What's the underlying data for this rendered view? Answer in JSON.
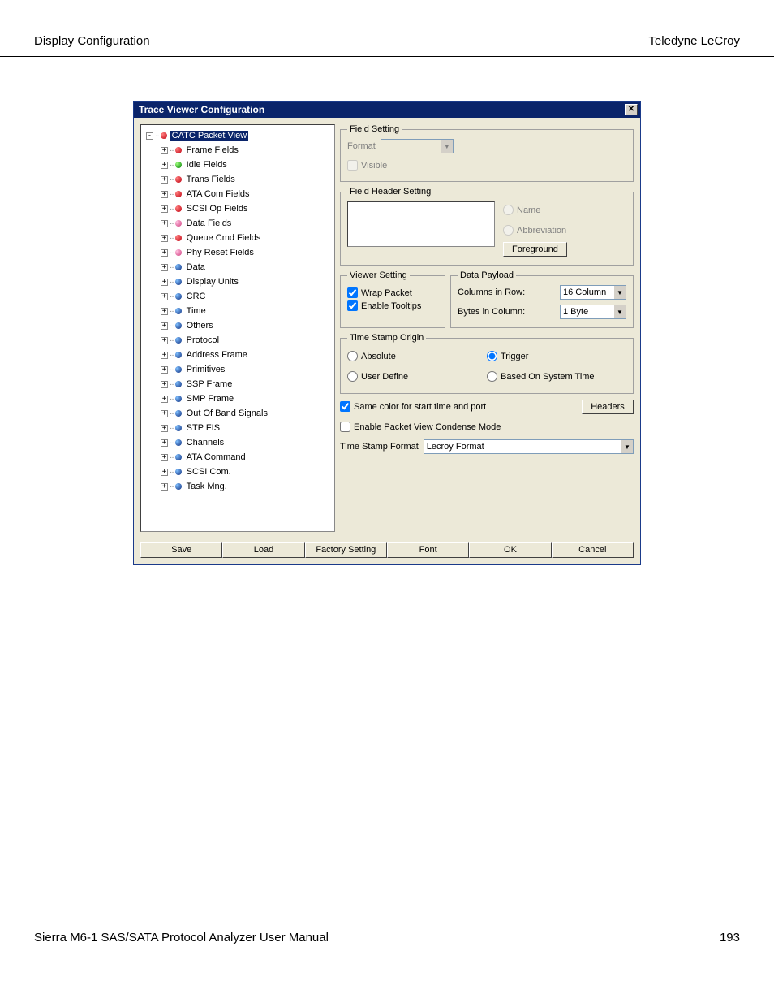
{
  "page": {
    "header_left": "Display Configuration",
    "header_right": "Teledyne LeCroy",
    "footer_left": "Sierra M6-1 SAS/SATA Protocol Analyzer User Manual",
    "footer_right": "193"
  },
  "dialog": {
    "title": "Trace Viewer Configuration"
  },
  "tree": {
    "root": {
      "label": "CATC Packet View",
      "color": "b-red",
      "exp": "-",
      "selected": true
    },
    "items": [
      {
        "label": "Frame Fields",
        "color": "b-red"
      },
      {
        "label": "Idle Fields",
        "color": "b-green"
      },
      {
        "label": "Trans Fields",
        "color": "b-red"
      },
      {
        "label": "ATA Com Fields",
        "color": "b-red"
      },
      {
        "label": "SCSI Op Fields",
        "color": "b-red"
      },
      {
        "label": "Data Fields",
        "color": "b-pink"
      },
      {
        "label": "Queue Cmd Fields",
        "color": "b-red"
      },
      {
        "label": "Phy Reset Fields",
        "color": "b-pink"
      },
      {
        "label": "Data",
        "color": "b-blue"
      },
      {
        "label": "Display Units",
        "color": "b-blue"
      },
      {
        "label": "CRC",
        "color": "b-blue"
      },
      {
        "label": "Time",
        "color": "b-blue"
      },
      {
        "label": "Others",
        "color": "b-blue"
      },
      {
        "label": "Protocol",
        "color": "b-blue"
      },
      {
        "label": "Address Frame",
        "color": "b-blue"
      },
      {
        "label": "Primitives",
        "color": "b-blue"
      },
      {
        "label": "SSP Frame",
        "color": "b-blue"
      },
      {
        "label": "SMP Frame",
        "color": "b-blue"
      },
      {
        "label": "Out Of Band Signals",
        "color": "b-blue"
      },
      {
        "label": "STP FIS",
        "color": "b-blue"
      },
      {
        "label": "Channels",
        "color": "b-blue"
      },
      {
        "label": "ATA Command",
        "color": "b-blue"
      },
      {
        "label": "SCSI Com.",
        "color": "b-blue"
      },
      {
        "label": "Task Mng.",
        "color": "b-blue"
      }
    ]
  },
  "field_setting": {
    "legend": "Field Setting",
    "format_label": "Format",
    "visible_label": "Visible"
  },
  "field_header": {
    "legend": "Field Header Setting",
    "name_label": "Name",
    "abbrev_label": "Abbreviation",
    "foreground_btn": "Foreground"
  },
  "viewer_setting": {
    "legend": "Viewer Setting",
    "wrap_label": "Wrap Packet",
    "tooltips_label": "Enable Tooltips"
  },
  "data_payload": {
    "legend": "Data Payload",
    "cols_label": "Columns in Row:",
    "cols_value": "16  Column",
    "bytes_label": "Bytes in Column:",
    "bytes_value": "1  Byte"
  },
  "time_origin": {
    "legend": "Time Stamp Origin",
    "absolute": "Absolute",
    "trigger": "Trigger",
    "user_define": "User Define",
    "system_time": "Based On System Time"
  },
  "misc": {
    "same_color": "Same color for start time and port",
    "headers_btn": "Headers",
    "condense": "Enable Packet View Condense Mode",
    "ts_format_label": "Time Stamp Format",
    "ts_format_value": "Lecroy Format"
  },
  "buttons": {
    "save": "Save",
    "load": "Load",
    "factory": "Factory Setting",
    "font": "Font",
    "ok": "OK",
    "cancel": "Cancel"
  }
}
